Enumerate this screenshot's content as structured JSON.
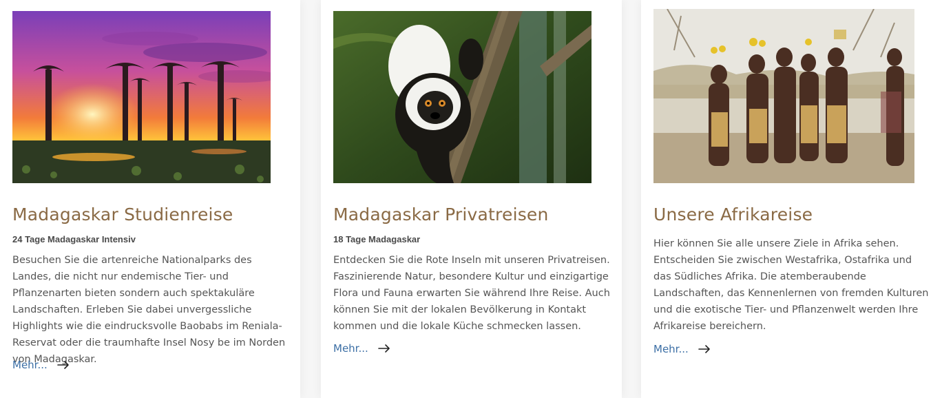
{
  "cards": [
    {
      "image": "baobab-sunset-image",
      "title": "Madagaskar Studienreise",
      "subtitle": "24 Tage Madagaskar Intensiv",
      "description": "Besuchen Sie die artenreiche Nationalparks des Landes, die nicht nur endemische Tier- und Pflanzenarten bieten sondern auch spektakuläre Landschaften. Erleben Sie dabei unvergessliche Highlights wie die eindrucksvolle Baobabs im Reniala-Reservat oder die traumhafte Insel Nosy be im Norden von Madagaskar.",
      "link_label": "Mehr..."
    },
    {
      "image": "lemur-image",
      "title": "Madagaskar Privatreisen",
      "subtitle": "18 Tage Madagaskar",
      "description": "Entdecken Sie die Rote Inseln mit unseren Privatreisen. Faszinierende Natur, besondere Kultur und einzigartige Flora und Fauna erwarten Sie während Ihre Reise. Auch können Sie mit der lokalen Bevölkerung in Kontakt kommen und die lokale Küche schmecken lassen.",
      "link_label": "Mehr..."
    },
    {
      "image": "african-tribe-image",
      "title": "Unsere Afrikareise",
      "description": "Hier können Sie alle unsere Ziele in Afrika sehen. Entscheiden Sie zwischen Westafrika, Ostafrika und das Südliches Afrika. Die atemberaubende Landschaften, das Kennenlernen von fremden Kulturen und die exotische Tier- und Pflanzenwelt werden Ihre Afrikareise bereichern.",
      "link_label": "Mehr..."
    }
  ],
  "colors": {
    "title": "#8a6a45",
    "link": "#3c6fa5",
    "body_text": "#555555"
  }
}
